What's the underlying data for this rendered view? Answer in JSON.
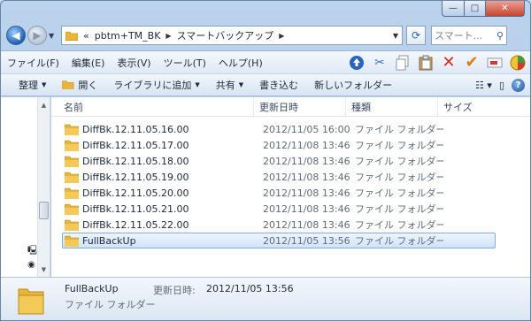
{
  "window": {
    "minimize_glyph": "—",
    "maximize_glyph": "□",
    "close_glyph": "✕"
  },
  "address": {
    "chevrons": "«",
    "crumbs": [
      "pbtm+TM_BK",
      "スマートバックアップ"
    ],
    "search_placeholder": "スマート..."
  },
  "menu": {
    "items": [
      "ファイル(F)",
      "編集(E)",
      "表示(V)",
      "ツール(T)",
      "ヘルプ(H)"
    ],
    "toolbar_icons": [
      "upload-icon",
      "scissors-icon",
      "copy-icon",
      "paste-icon",
      "delete-icon",
      "check-icon",
      "rename-icon",
      "properties-icon"
    ]
  },
  "commandbar": {
    "organize": "整理",
    "open": "開く",
    "include_library": "ライブラリに追加",
    "share": "共有",
    "burn": "書き込む",
    "new_folder": "新しいフォルダー"
  },
  "columns": {
    "name": "名前",
    "date": "更新日時",
    "type": "種類",
    "size": "サイズ"
  },
  "files": [
    {
      "name": "DiffBk.12.11.05.16.00",
      "date": "2012/11/05 16:00",
      "type": "ファイル フォルダー",
      "selected": false
    },
    {
      "name": "DiffBk.12.11.05.17.00",
      "date": "2012/11/08 13:46",
      "type": "ファイル フォルダー",
      "selected": false
    },
    {
      "name": "DiffBk.12.11.05.18.00",
      "date": "2012/11/08 13:46",
      "type": "ファイル フォルダー",
      "selected": false
    },
    {
      "name": "DiffBk.12.11.05.19.00",
      "date": "2012/11/08 13:46",
      "type": "ファイル フォルダー",
      "selected": false
    },
    {
      "name": "DiffBk.12.11.05.20.00",
      "date": "2012/11/08 13:46",
      "type": "ファイル フォルダー",
      "selected": false
    },
    {
      "name": "DiffBk.12.11.05.21.00",
      "date": "2012/11/08 13:46",
      "type": "ファイル フォルダー",
      "selected": false
    },
    {
      "name": "DiffBk.12.11.05.22.00",
      "date": "2012/11/08 13:46",
      "type": "ファイル フォルダー",
      "selected": false
    },
    {
      "name": "FullBackUp",
      "date": "2012/11/05 13:56",
      "type": "ファイル フォルダー",
      "selected": true
    }
  ],
  "details": {
    "name": "FullBackUp",
    "type": "ファイル フォルダー",
    "date_label": "更新日時:",
    "date": "2012/11/05 13:56"
  },
  "colors": {
    "selection_bg": "#cfe3fa",
    "selection_border": "#84acdd",
    "folder": "#e8b53a"
  }
}
